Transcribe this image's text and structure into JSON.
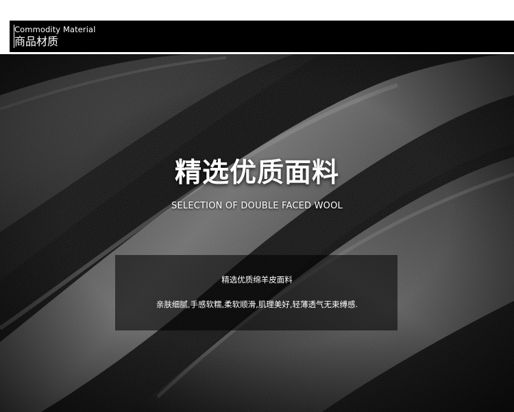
{
  "header": {
    "title_en": "Commodity Material",
    "title_cn": "商品材质"
  },
  "hero": {
    "heading_cn": "精选优质面料",
    "heading_en": "SELECTION OF DOUBLE FACED WOOL",
    "material_title": "精选优质绵羊皮面料",
    "material_desc": "亲肤细腻,手感软糯,柔软顺滑,肌理美好,轻薄透气无束缚感."
  },
  "colors": {
    "background": "#0c0c0c",
    "leather_highlight": "#8a8a8a",
    "text": "#ffffff"
  }
}
